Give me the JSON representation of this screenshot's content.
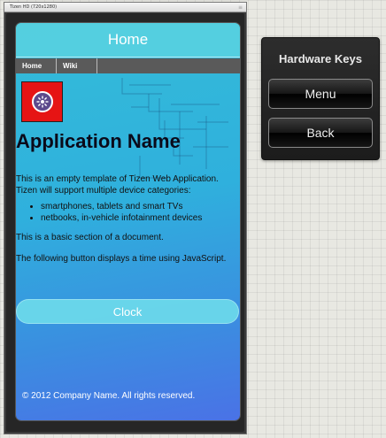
{
  "emulator": {
    "window_title": "Tizen HD (720x1280)"
  },
  "app": {
    "header_title": "Home",
    "nav": [
      {
        "label": "Home"
      },
      {
        "label": "Wiki"
      }
    ],
    "icon": "tizen-logo-icon",
    "title": "Application Name",
    "intro": "This is an empty template of Tizen Web Application. Tizen will support multiple device categories:",
    "list": [
      "smartphones, tablets and smart TVs",
      "netbooks, in-vehicle infotainment devices"
    ],
    "section_text": "This is a basic section of a document.",
    "button_text": "The following button displays a time using JavaScript.",
    "clock_label": "Clock",
    "footer": "© 2012 Company Name. All rights reserved.",
    "colors": {
      "header": "#5ad2e1",
      "icon_bg": "#e61414",
      "nav_bg": "#5a5a5a"
    }
  },
  "hardware_keys": {
    "title": "Hardware Keys",
    "menu_label": "Menu",
    "back_label": "Back"
  }
}
